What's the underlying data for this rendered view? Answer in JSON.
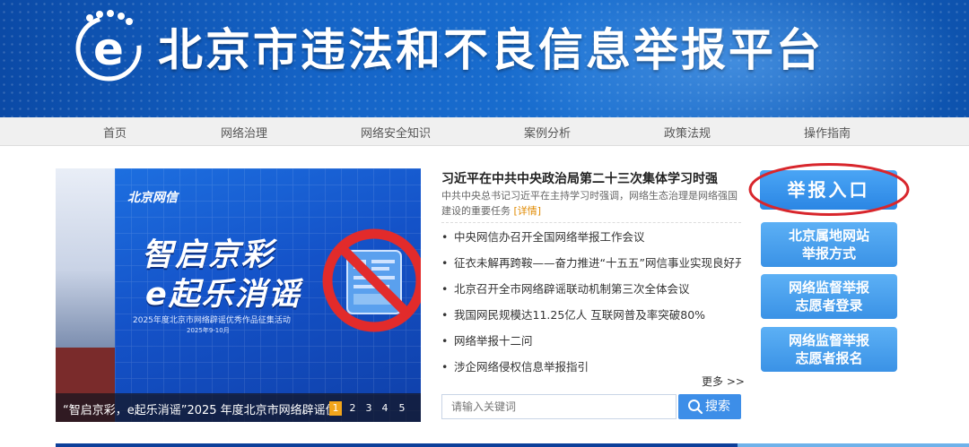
{
  "header": {
    "title": "北京市违法和不良信息举报平台",
    "logo_letter": "e"
  },
  "nav": [
    "首页",
    "网络治理",
    "网络安全知识",
    "案例分析",
    "政策法规",
    "操作指南"
  ],
  "slide": {
    "brand_tag": "北京网信",
    "slogan_line1": "智启京彩",
    "slogan_line2": "e起乐消谣",
    "event": "2025年度北京市网络辟谣优秀作品征集活动",
    "event_date": "2025年9-10月",
    "caption": "“智启京彩，e起乐消谣”2025 年度北京市网络辟谣优秀作品征集活动",
    "pages": [
      "1",
      "2",
      "3",
      "4",
      "5"
    ],
    "active_page": 1
  },
  "news": {
    "headline": "习近平在中共中央政治局第二十三次集体学习时强",
    "summary": "中共中央总书记习近平在主持学习时强调，网络生态治理是网络强国建设的重要任务",
    "detail_link": "[详情]",
    "items": [
      "中央网信办召开全国网络举报工作会议",
      "征衣未解再跨鞍——奋力推进“十五五”网信事业实现良好开局",
      "北京召开全市网络辟谣联动机制第三次全体会议",
      "我国网民规模达11.25亿人 互联网普及率突破80%",
      "网络举报十二问",
      "涉企网络侵权信息举报指引"
    ],
    "more": "更多 >>"
  },
  "search": {
    "placeholder": "请输入关键词",
    "button": "搜索"
  },
  "side": {
    "main": "举报入口",
    "buttons": [
      [
        "北京属地网站",
        "举报方式"
      ],
      [
        "网络监督举报",
        "志愿者登录"
      ],
      [
        "网络监督举报",
        "志愿者报名"
      ]
    ]
  },
  "colors": {
    "primary": "#1565c8",
    "accent": "#f2a51b",
    "ring": "#d8262c"
  }
}
